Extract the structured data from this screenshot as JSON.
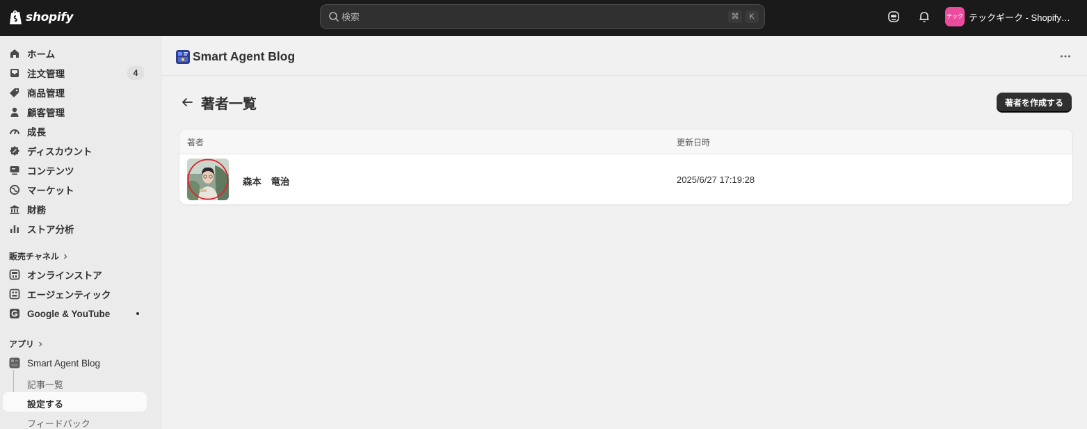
{
  "topbar": {
    "logo_text": "shopify",
    "search_placeholder": "検索",
    "shortcut_cmd": "⌘",
    "shortcut_key": "K",
    "store_badge": "テック",
    "store_name": "テックギーク - Shopifyア..."
  },
  "sidebar": {
    "items": [
      {
        "label": "ホーム",
        "icon": "home-icon"
      },
      {
        "label": "注文管理",
        "icon": "inbox-icon",
        "count": "4"
      },
      {
        "label": "商品管理",
        "icon": "tag-icon"
      },
      {
        "label": "顧客管理",
        "icon": "person-icon"
      },
      {
        "label": "成長",
        "icon": "gauge-icon"
      },
      {
        "label": "ディスカウント",
        "icon": "discount-icon"
      },
      {
        "label": "コンテンツ",
        "icon": "content-icon"
      },
      {
        "label": "マーケット",
        "icon": "globe-icon"
      },
      {
        "label": "財務",
        "icon": "bank-icon"
      },
      {
        "label": "ストア分析",
        "icon": "bar-chart-icon"
      }
    ],
    "sales_channels_label": "販売チャネル",
    "channels": [
      {
        "label": "オンラインストア",
        "icon": "store-icon"
      },
      {
        "label": "エージェンティック",
        "icon": "agentic-icon"
      },
      {
        "label": "Google & YouTube",
        "icon": "google-icon"
      }
    ],
    "apps_label": "アプリ",
    "app": {
      "label": "Smart Agent Blog",
      "icon": "app-icon"
    },
    "app_subitems": [
      {
        "label": "記事一覧"
      },
      {
        "label": "設定する"
      },
      {
        "label": "フィードバック"
      }
    ]
  },
  "appbar": {
    "title": "Smart Agent Blog"
  },
  "page": {
    "title": "著者一覧",
    "create_button": "著者を作成する"
  },
  "table": {
    "columns": [
      "著者",
      "更新日時"
    ],
    "rows": [
      {
        "author": "森本　竜治",
        "updated": "2025/6/27 17:19:28"
      }
    ]
  },
  "colors": {
    "topbar_bg": "#1a1a1a",
    "store_badge": "#ed4c9e",
    "primary_button": "#303030",
    "avatar_highlight": "#e0202a"
  }
}
